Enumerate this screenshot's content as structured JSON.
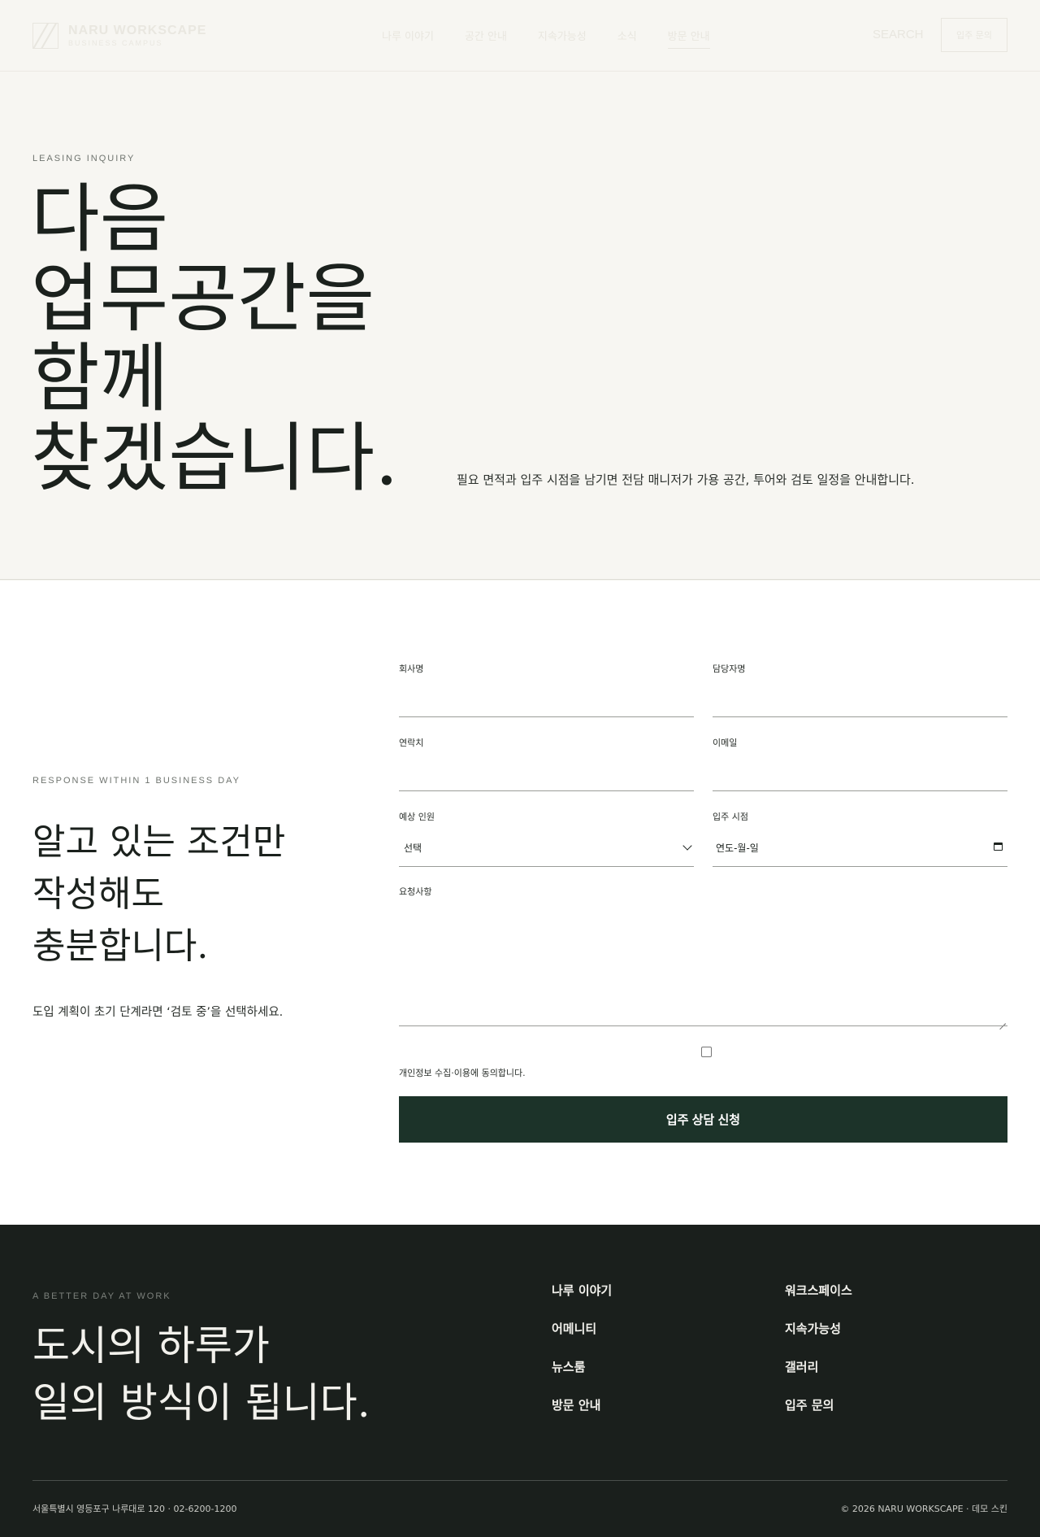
{
  "header": {
    "logo_name": "NARU WORKSCAPE",
    "logo_sub": "BUSINESS CAMPUS",
    "nav": [
      "나루 이야기",
      "공간 안내",
      "지속가능성",
      "소식",
      "방문 안내"
    ],
    "active_nav": "방문 안내",
    "search_label": "SEARCH",
    "cta_label": "입주 문의"
  },
  "hero": {
    "eyebrow": "LEASING INQUIRY",
    "title_lines": [
      "다음",
      "업무공간을",
      "함께",
      "찾겠습니다."
    ],
    "description": "필요 면적과 입주 시점을 남기면 전담 매니저가 가용 공간, 투어와 검토 일정을 안내합니다."
  },
  "form_section": {
    "eyebrow": "RESPONSE WITHIN 1 BUSINESS DAY",
    "title_lines": [
      "알고 있는 조건만",
      "작성해도",
      "충분합니다."
    ],
    "note": "도입 계획이 초기 단계라면 ‘검토 중’을 선택하세요."
  },
  "form": {
    "company_label": "회사명",
    "contact_name_label": "담당자명",
    "phone_label": "연락치",
    "email_label": "이메일",
    "headcount_label": "예상 인원",
    "headcount_value": "선택",
    "move_in_label": "입주 시점",
    "move_in_value": "연도-월-일",
    "request_label": "요청사항",
    "consent_label": "개인정보 수집·이용에 동의합니다.",
    "submit_label": "입주 상담 신청"
  },
  "footer": {
    "eyebrow": "A BETTER DAY AT WORK",
    "title_lines": [
      "도시의 하루가",
      "일의 방식이 됩니다."
    ],
    "links": [
      "나루 이야기",
      "워크스페이스",
      "어메니티",
      "지속가능성",
      "뉴스룸",
      "갤러리",
      "방문 안내",
      "입주 문의"
    ],
    "address": "서울특별시 영등포구 나루대로 120 · 02-6200-1200",
    "copyright": "© 2026 NARU WORKSCAPE · 데모 스킨"
  }
}
